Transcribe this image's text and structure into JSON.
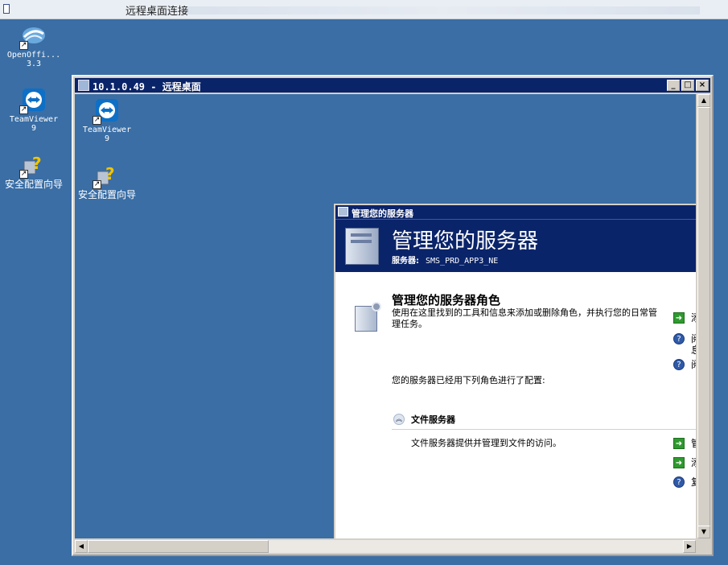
{
  "outer": {
    "title": "远程桌面连接"
  },
  "desktop_icons": [
    {
      "name": "openoffice",
      "label": "OpenOffi...\n3.3"
    },
    {
      "name": "teamviewer",
      "label": "TeamViewer\n9"
    },
    {
      "name": "security-wizard",
      "label": "安全配置向导"
    }
  ],
  "rdp": {
    "title": "10.1.0.49 - 远程桌面",
    "buttons": {
      "minimize": "_",
      "maximize": "□",
      "close": "×"
    },
    "icons": [
      {
        "label": "TeamViewer\n9"
      },
      {
        "label": "安全配置向导"
      }
    ]
  },
  "manager": {
    "window_title": "管理您的服务器",
    "banner_title": "管理您的服务器",
    "server_label": "服务器:",
    "server_name": "SMS_PRD_APP3_NE",
    "roles_heading": "管理您的服务器角色",
    "roles_desc": "使用在这里找到的工具和信息来添加或删除角色，并执行您的日常管理任务。",
    "configured_text": "您的服务器已经用下列角色进行了配置:",
    "file_server_title": "文件服务器",
    "file_server_desc": "文件服务器提供并管理到文件的访问。",
    "top_actions": [
      {
        "icon": "arrow",
        "text": "添"
      },
      {
        "icon": "help",
        "text": "阅\n息"
      },
      {
        "icon": "help",
        "text": "阅"
      }
    ],
    "fs_actions": [
      {
        "icon": "arrow",
        "text": "管"
      },
      {
        "icon": "arrow",
        "text": "添"
      },
      {
        "icon": "help",
        "text": "复"
      }
    ]
  },
  "colors": {
    "desktop": "#3a6ea5",
    "titlebar": "#0a246a",
    "window_face": "#d4d0c8"
  }
}
